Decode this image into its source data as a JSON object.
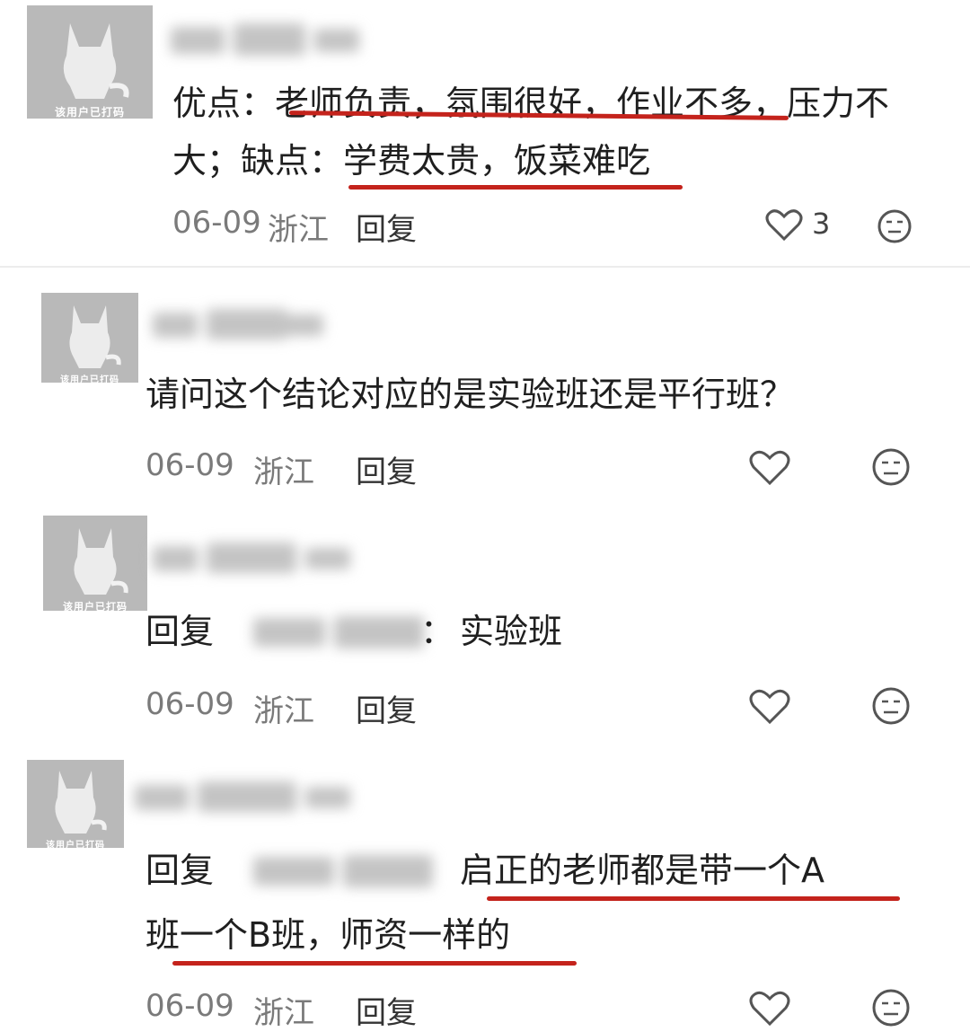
{
  "colors": {
    "underline": "#c4231c",
    "avatar_bg": "#b9b9b9",
    "meta": "#7a7a7a"
  },
  "comments": [
    {
      "avatar_tag": "该用户已打码",
      "lines": [
        "优点：老师负责，氛围很好，作业不多，压力不",
        "大；缺点：学费太贵，饭菜难吃"
      ],
      "date": "06-09",
      "location": "浙江",
      "reply_label": "回复",
      "like_count": "3"
    },
    {
      "avatar_tag": "该用户已打码",
      "lines": [
        "请问这个结论对应的是实验班还是平行班？"
      ],
      "date": "06-09",
      "location": "浙江",
      "reply_label": "回复"
    },
    {
      "avatar_tag": "该用户已打码",
      "reply_prefix": "回复",
      "colon": "：",
      "text": "实验班",
      "date": "06-09",
      "location": "浙江",
      "reply_label": "回复"
    },
    {
      "avatar_tag": "该用户已打码",
      "reply_prefix": "回复",
      "line1": "启正的老师都是带一个A",
      "line2": "班一个B班，师资一样的",
      "date": "06-09",
      "location": "浙江",
      "reply_label": "回复"
    }
  ],
  "icons": [
    "heart-icon",
    "face-icon"
  ]
}
